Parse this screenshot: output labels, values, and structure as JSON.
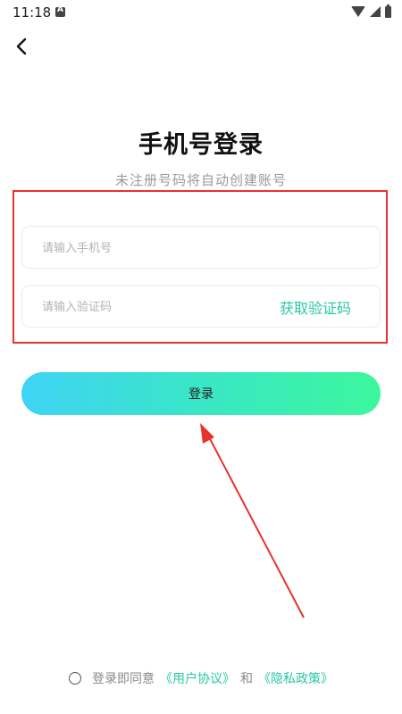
{
  "status_bar": {
    "time": "11:18",
    "notif_letter": "A"
  },
  "header": {
    "back_icon": "chevron-left-icon"
  },
  "title": "手机号登录",
  "subtitle": "未注册号码将自动创建账号",
  "phone": {
    "placeholder": "请输入手机号",
    "value": ""
  },
  "code": {
    "placeholder": "请输入验证码",
    "value": "",
    "get_code_label": "获取验证码"
  },
  "login_button": {
    "label": "登录"
  },
  "agreement": {
    "prefix": "登录即同意",
    "user_agreement": "《用户协议》",
    "and": "和",
    "privacy_policy": "《隐私政策》"
  },
  "colors": {
    "accent": "#27c8a6",
    "gradient_start": "#3fd3f5",
    "gradient_end": "#3cf79d",
    "annotation_red": "#e8322e"
  }
}
